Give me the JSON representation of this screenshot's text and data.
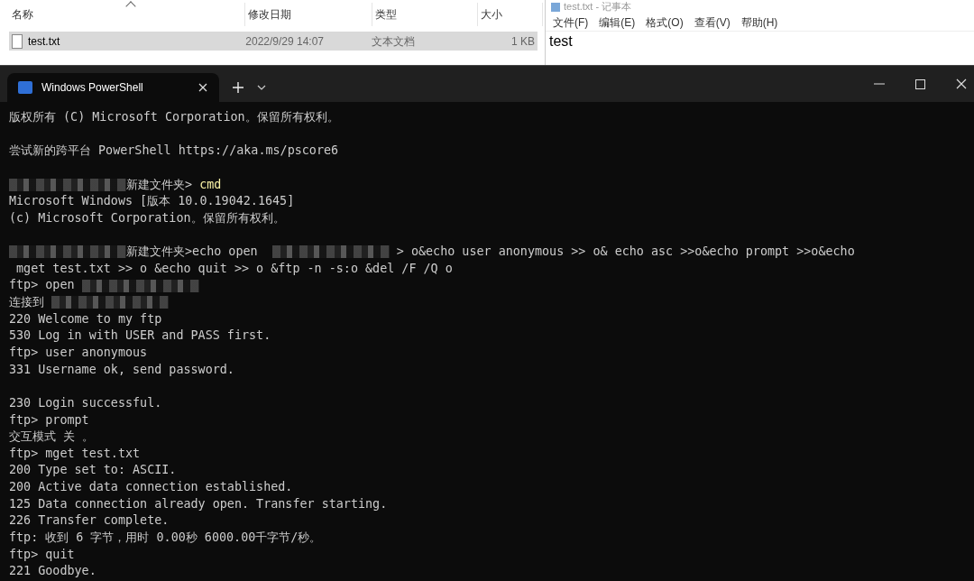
{
  "explorer": {
    "columns": [
      {
        "label": "名称",
        "sorted": true
      },
      {
        "label": "修改日期",
        "sorted": false
      },
      {
        "label": "类型",
        "sorted": false
      },
      {
        "label": "大小",
        "sorted": false
      }
    ],
    "rows": [
      {
        "name": "test.txt",
        "modified": "2022/9/29 14:07",
        "type": "文本文档",
        "size": "1 KB",
        "selected": true
      }
    ]
  },
  "notepad": {
    "title": "test.txt - 记事本",
    "menu": [
      "文件(F)",
      "编辑(E)",
      "格式(O)",
      "查看(V)",
      "帮助(H)"
    ],
    "content": "test"
  },
  "terminal": {
    "tabs": [
      {
        "label": "Windows PowerShell",
        "selected": true
      }
    ],
    "lines": [
      {
        "kind": "text",
        "parts": [
          {
            "kind": "text",
            "text": "版权所有 (C) Microsoft Corporation。保留所有权利。"
          }
        ]
      },
      {
        "kind": "blank"
      },
      {
        "kind": "text",
        "parts": [
          {
            "kind": "text",
            "text": "尝试新的跨平台 PowerShell https://aka.ms/pscore6"
          }
        ]
      },
      {
        "kind": "blank"
      },
      {
        "kind": "text",
        "parts": [
          {
            "kind": "redacted"
          },
          {
            "kind": "text",
            "text": "新建文件夹> "
          },
          {
            "kind": "command",
            "text": "cmd"
          }
        ]
      },
      {
        "kind": "text",
        "parts": [
          {
            "kind": "text",
            "text": "Microsoft Windows [版本 10.0.19042.1645]"
          }
        ]
      },
      {
        "kind": "text",
        "parts": [
          {
            "kind": "text",
            "text": "(c) Microsoft Corporation。保留所有权利。"
          }
        ]
      },
      {
        "kind": "blank"
      },
      {
        "kind": "text",
        "parts": [
          {
            "kind": "redacted"
          },
          {
            "kind": "text",
            "text": "新建文件夹>echo open  "
          },
          {
            "kind": "redacted"
          },
          {
            "kind": "text",
            "text": " > o&echo user anonymous >> o& echo asc >>o&echo prompt >>o&echo"
          }
        ]
      },
      {
        "kind": "text",
        "parts": [
          {
            "kind": "text",
            "text": " mget test.txt >> o &echo quit >> o &ftp -n -s:o &del /F /Q o"
          }
        ]
      },
      {
        "kind": "text",
        "parts": [
          {
            "kind": "text",
            "text": "ftp> open "
          },
          {
            "kind": "redacted"
          }
        ]
      },
      {
        "kind": "text",
        "parts": [
          {
            "kind": "text",
            "text": "连接到 "
          },
          {
            "kind": "redacted"
          }
        ]
      },
      {
        "kind": "text",
        "parts": [
          {
            "kind": "text",
            "text": "220 Welcome to my ftp"
          }
        ]
      },
      {
        "kind": "text",
        "parts": [
          {
            "kind": "text",
            "text": "530 Log in with USER and PASS first."
          }
        ]
      },
      {
        "kind": "text",
        "parts": [
          {
            "kind": "text",
            "text": "ftp> user anonymous"
          }
        ]
      },
      {
        "kind": "text",
        "parts": [
          {
            "kind": "text",
            "text": "331 Username ok, send password."
          }
        ]
      },
      {
        "kind": "blank"
      },
      {
        "kind": "text",
        "parts": [
          {
            "kind": "text",
            "text": "230 Login successful."
          }
        ]
      },
      {
        "kind": "text",
        "parts": [
          {
            "kind": "text",
            "text": "ftp> prompt"
          }
        ]
      },
      {
        "kind": "text",
        "parts": [
          {
            "kind": "text",
            "text": "交互模式 关 。"
          }
        ]
      },
      {
        "kind": "text",
        "parts": [
          {
            "kind": "text",
            "text": "ftp> mget test.txt"
          }
        ]
      },
      {
        "kind": "text",
        "parts": [
          {
            "kind": "text",
            "text": "200 Type set to: ASCII."
          }
        ]
      },
      {
        "kind": "text",
        "parts": [
          {
            "kind": "text",
            "text": "200 Active data connection established."
          }
        ]
      },
      {
        "kind": "text",
        "parts": [
          {
            "kind": "text",
            "text": "125 Data connection already open. Transfer starting."
          }
        ]
      },
      {
        "kind": "text",
        "parts": [
          {
            "kind": "text",
            "text": "226 Transfer complete."
          }
        ]
      },
      {
        "kind": "text",
        "parts": [
          {
            "kind": "text",
            "text": "ftp: 收到 6 字节，用时 0.00秒 6000.00千字节/秒。"
          }
        ]
      },
      {
        "kind": "text",
        "parts": [
          {
            "kind": "text",
            "text": "ftp> quit"
          }
        ]
      },
      {
        "kind": "text",
        "parts": [
          {
            "kind": "text",
            "text": "221 Goodbye."
          }
        ]
      }
    ]
  }
}
